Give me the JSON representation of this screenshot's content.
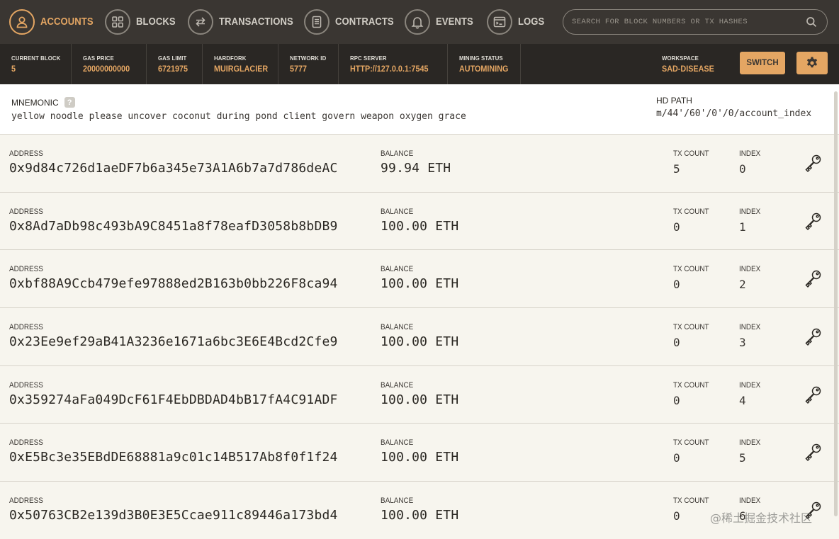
{
  "nav": {
    "items": [
      {
        "label": "ACCOUNTS",
        "icon": "user-icon"
      },
      {
        "label": "BLOCKS",
        "icon": "grid-icon"
      },
      {
        "label": "TRANSACTIONS",
        "icon": "swap-arrows-icon"
      },
      {
        "label": "CONTRACTS",
        "icon": "document-icon"
      },
      {
        "label": "EVENTS",
        "icon": "bell-icon"
      },
      {
        "label": "LOGS",
        "icon": "terminal-icon"
      }
    ],
    "active": "ACCOUNTS"
  },
  "search": {
    "placeholder": "SEARCH FOR BLOCK NUMBERS OR TX HASHES"
  },
  "status": {
    "current_block": {
      "label": "CURRENT BLOCK",
      "value": "5"
    },
    "gas_price": {
      "label": "GAS PRICE",
      "value": "20000000000"
    },
    "gas_limit": {
      "label": "GAS LIMIT",
      "value": "6721975"
    },
    "hardfork": {
      "label": "HARDFORK",
      "value": "MUIRGLACIER"
    },
    "network_id": {
      "label": "NETWORK ID",
      "value": "5777"
    },
    "rpc_server": {
      "label": "RPC SERVER",
      "value": "HTTP://127.0.0.1:7545"
    },
    "mining_status": {
      "label": "MINING STATUS",
      "value": "AUTOMINING"
    },
    "workspace": {
      "label": "WORKSPACE",
      "value": "SAD-DISEASE"
    },
    "switch_label": "SWITCH"
  },
  "mnemonic": {
    "label": "MNEMONIC",
    "help": "?",
    "phrase": "yellow noodle please uncover coconut during pond client govern weapon oxygen grace",
    "hd_label": "HD PATH",
    "hd_path": "m/44'/60'/0'/0/account_index"
  },
  "field_labels": {
    "address": "ADDRESS",
    "balance": "BALANCE",
    "tx_count": "TX COUNT",
    "index": "INDEX"
  },
  "accounts": [
    {
      "address": "0x9d84c726d1aeDF7b6a345e73A1A6b7a7d786deAC",
      "balance": "99.94 ETH",
      "tx_count": "5",
      "index": "0"
    },
    {
      "address": "0x8Ad7aDb98c493bA9C8451a8f78eafD3058b8bDB9",
      "balance": "100.00 ETH",
      "tx_count": "0",
      "index": "1"
    },
    {
      "address": "0xbf88A9Ccb479efe97888ed2B163b0bb226F8ca94",
      "balance": "100.00 ETH",
      "tx_count": "0",
      "index": "2"
    },
    {
      "address": "0x23Ee9ef29aB41A3236e1671a6bc3E6E4Bcd2Cfe9",
      "balance": "100.00 ETH",
      "tx_count": "0",
      "index": "3"
    },
    {
      "address": "0x359274aFa049DcF61F4EbDBDAD4bB17fA4C91ADF",
      "balance": "100.00 ETH",
      "tx_count": "0",
      "index": "4"
    },
    {
      "address": "0xE5Bc3e35EBdDE68881a9c01c14B517Ab8f0f1f24",
      "balance": "100.00 ETH",
      "tx_count": "0",
      "index": "5"
    },
    {
      "address": "0x50763CB2e139d3B0E3E5Ccae911c89446a173bd4",
      "balance": "100.00 ETH",
      "tx_count": "0",
      "index": "6"
    }
  ],
  "watermark": "@稀土掘金技术社区",
  "colors": {
    "accent": "#e4a663",
    "nav_bg": "#3a3632",
    "status_bg": "#2a2724",
    "page_bg": "#f7f5ee"
  }
}
